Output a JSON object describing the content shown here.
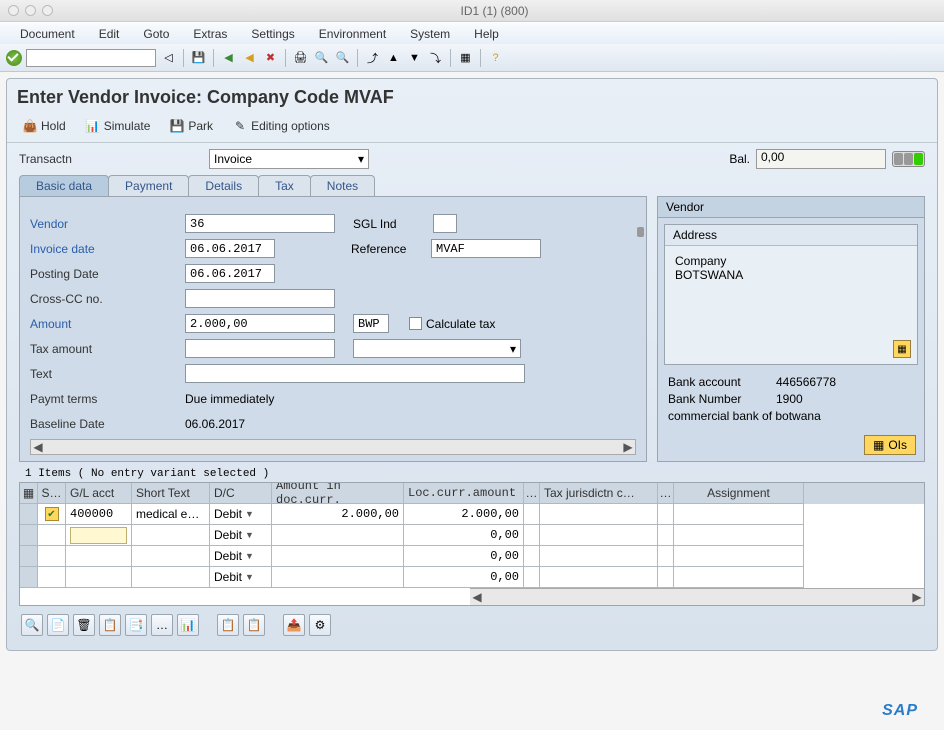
{
  "window": {
    "title": "ID1 (1) (800)"
  },
  "menu": [
    "Document",
    "Edit",
    "Goto",
    "Extras",
    "Settings",
    "Environment",
    "System",
    "Help"
  ],
  "page": {
    "title": "Enter Vendor Invoice: Company Code MVAF"
  },
  "actions": {
    "hold": "Hold",
    "simulate": "Simulate",
    "park": "Park",
    "editopts": "Editing options"
  },
  "trans": {
    "label": "Transactn",
    "value": "Invoice"
  },
  "balance": {
    "label": "Bal.",
    "value": "0,00"
  },
  "tabs": [
    "Basic data",
    "Payment",
    "Details",
    "Tax",
    "Notes"
  ],
  "form": {
    "vendor_label": "Vendor",
    "vendor_value": "36",
    "sgl_label": "SGL Ind",
    "invdate_label": "Invoice date",
    "invdate_value": "06.06.2017",
    "ref_label": "Reference",
    "ref_value": "MVAF",
    "postdate_label": "Posting Date",
    "postdate_value": "06.06.2017",
    "crosscc_label": "Cross-CC no.",
    "amount_label": "Amount",
    "amount_value": "2.000,00",
    "currency": "BWP",
    "calctax_label": "Calculate tax",
    "taxamt_label": "Tax amount",
    "text_label": "Text",
    "payterms_label": "Paymt terms",
    "payterms_value": "Due immediately",
    "baseline_label": "Baseline Date",
    "baseline_value": "06.06.2017"
  },
  "vendor_panel": {
    "header": "Vendor",
    "address_header": "Address",
    "company": "Company",
    "country": "BOTSWANA",
    "bankacct_label": "Bank account",
    "bankacct_value": "446566778",
    "banknum_label": "Bank Number",
    "banknum_value": "1900",
    "bankname": "commercial bank of botwana",
    "ols_label": "OIs"
  },
  "items": {
    "title": "1 Items ( No entry variant selected )",
    "headers": {
      "st": "S…",
      "gl": "G/L acct",
      "short": "Short Text",
      "dc": "D/C",
      "amt": "Amount in doc.curr.",
      "loc": "Loc.curr.amount",
      "dots": "…",
      "tax": "Tax jurisdictn c…",
      "d2": "…",
      "assign": "Assignment"
    },
    "rows": [
      {
        "ok": true,
        "gl": "400000",
        "short": "medical e…",
        "dc": "Debit",
        "amt": "2.000,00",
        "loc": "2.000,00"
      },
      {
        "gl": "",
        "short": "",
        "dc": "Debit",
        "amt": "",
        "loc": "0,00",
        "yellow": true
      },
      {
        "gl": "",
        "short": "",
        "dc": "Debit",
        "amt": "",
        "loc": "0,00"
      },
      {
        "gl": "",
        "short": "",
        "dc": "Debit",
        "amt": "",
        "loc": "0,00"
      }
    ]
  },
  "footer": {
    "logo": "SAP"
  }
}
